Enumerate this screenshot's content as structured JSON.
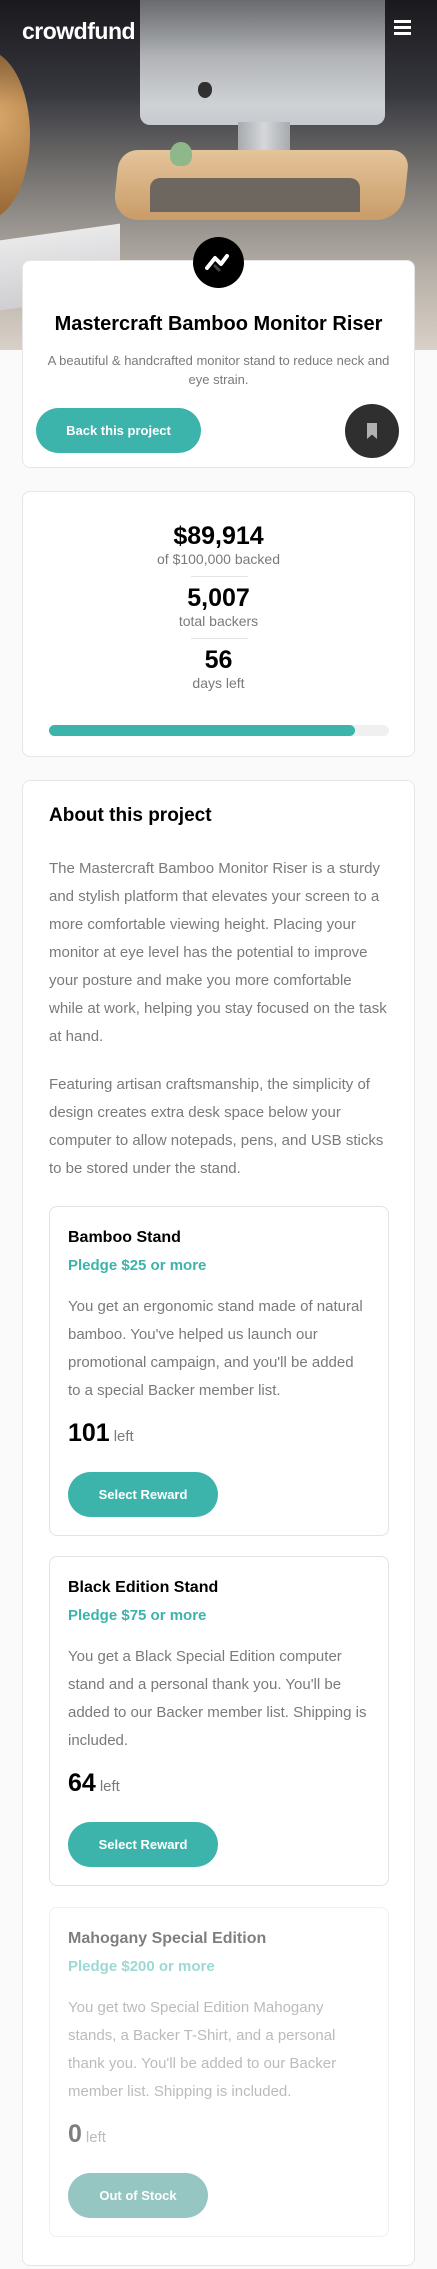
{
  "header": {
    "logo": "crowdfund",
    "menu_icon": "hamburger-menu-icon"
  },
  "project": {
    "logo_icon": "mastercraft-logo-icon",
    "title": "Mastercraft Bamboo Monitor Riser",
    "subtitle": "A beautiful & handcrafted monitor stand to reduce neck and eye strain.",
    "back_label": "Back this project",
    "bookmark_icon": "bookmark-icon"
  },
  "stats": {
    "backed_amount": "$89,914",
    "backed_label": "of $100,000 backed",
    "backers": "5,007",
    "backers_label": "total backers",
    "days": "56",
    "days_label": "days left",
    "progress_fraction": 0.899
  },
  "about": {
    "title": "About this project",
    "p1": "The Mastercraft Bamboo Monitor Riser is a sturdy and stylish platform that elevates your screen to a more comfortable viewing height. Placing your monitor at eye level has the potential to improve your posture and make you more comfortable while at work, helping you stay focused on the task at hand.",
    "p2": "Featuring artisan craftsmanship, the simplicity of design creates extra desk space below your computer to allow notepads, pens, and USB sticks to be stored under the stand."
  },
  "rewards": [
    {
      "name": "Bamboo Stand",
      "pledge": "Pledge $25 or more",
      "description": "You get an ergonomic stand made of natural bamboo. You've helped us launch our promotional campaign, and you'll be added to a special Backer member list.",
      "count": "101",
      "left_label": "left",
      "button": "Select Reward"
    },
    {
      "name": "Black Edition Stand",
      "pledge": "Pledge $75 or more",
      "description": "You get a Black Special Edition computer stand and a personal thank you. You'll be added to our Backer member list. Shipping is included.",
      "count": "64",
      "left_label": "left",
      "button": "Select Reward"
    },
    {
      "name": "Mahogany Special Edition",
      "pledge": "Pledge $200 or more",
      "description": "You get two Special Edition Mahogany stands, a Backer T-Shirt, and a personal thank you. You'll be added to our Backer member list. Shipping is included.",
      "count": "0",
      "left_label": "left",
      "button": "Out of Stock"
    }
  ],
  "colors": {
    "accent": "#3cb3ab",
    "accent_dark": "#147a73",
    "text_muted": "#7a7a7a"
  }
}
